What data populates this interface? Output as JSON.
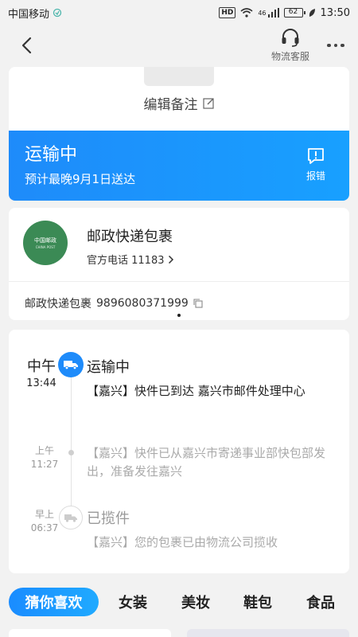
{
  "status_bar": {
    "carrier": "中国移动",
    "hd": "HD",
    "signal": "46",
    "battery": "62",
    "time": "13:50"
  },
  "header": {
    "back_icon": "chevron-left-icon",
    "service_label": "物流客服",
    "service_icon": "headset-icon",
    "more_icon": "more-dots-icon"
  },
  "note": {
    "edit_label": "编辑备注",
    "edit_icon": "pencil-icon"
  },
  "status": {
    "title": "运输中",
    "eta": "预计最晚9月1日送达",
    "report_label": "报错",
    "report_icon": "alert-message-icon",
    "color": "#1e8bfa"
  },
  "courier": {
    "logo_text": "中国邮政",
    "logo_subtext": "CHINA POST",
    "logo_color": "#3b8a55",
    "name": "邮政快递包裹",
    "phone_label": "官方电话 11183",
    "tracking_label": "邮政快递包裹",
    "tracking_number": "9896080371999"
  },
  "timeline": [
    {
      "time_1": "中午",
      "time_2": "13:44",
      "title": "运输中",
      "desc": "【嘉兴】快件已到达 嘉兴市邮件处理中心",
      "active": true
    },
    {
      "time_1": "上午",
      "time_2": "11:27",
      "title": "",
      "desc": "【嘉兴】快件已从嘉兴市寄递事业部快包部发出，准备发往嘉兴",
      "active": false
    },
    {
      "time_1": "早上",
      "time_2": "06:37",
      "title": "已揽件",
      "desc": "【嘉兴】您的包裹已由物流公司揽收",
      "active": false
    }
  ],
  "tabs": [
    "猜你喜欢",
    "女装",
    "美妆",
    "鞋包",
    "食品"
  ]
}
